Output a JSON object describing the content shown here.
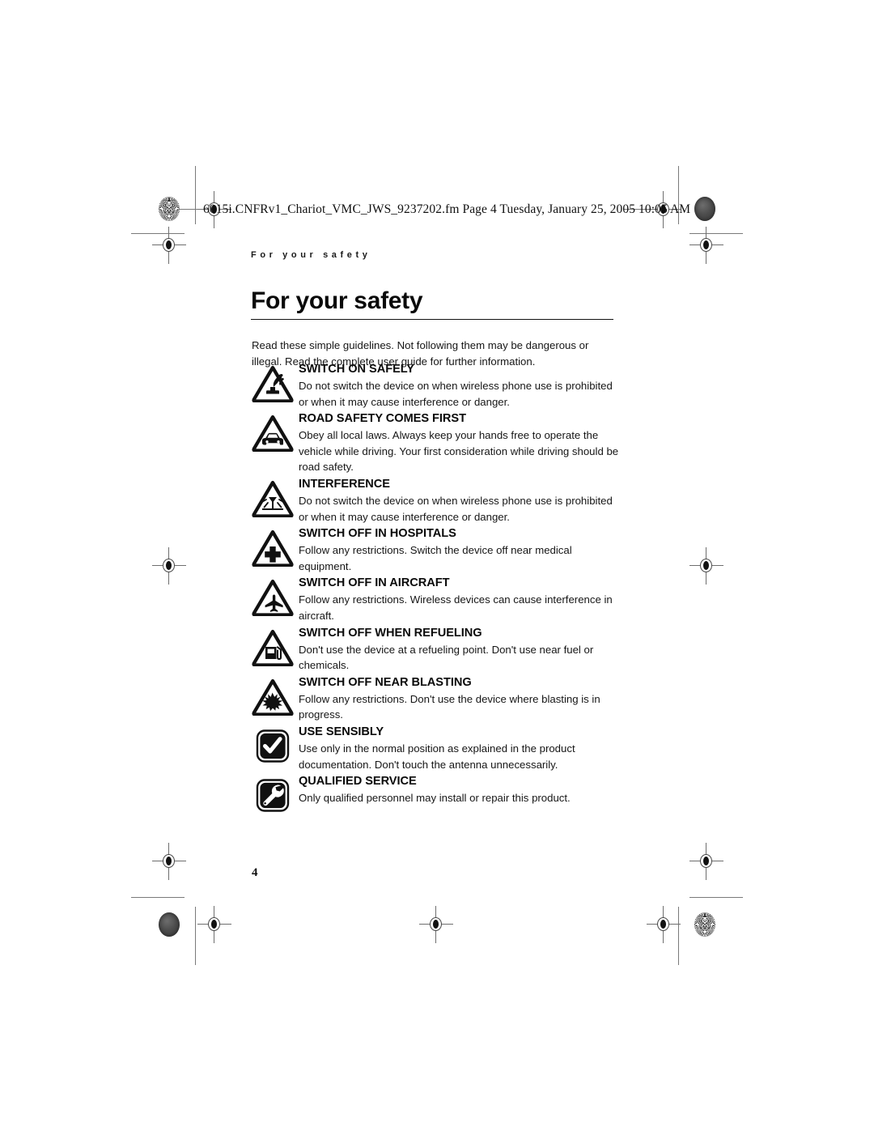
{
  "document": {
    "fm_header": "6015i.CNFRv1_Chariot_VMC_JWS_9237202.fm  Page 4  Tuesday, January 25, 2005  10:05 AM",
    "running_head": "For your safety",
    "title": "For your safety",
    "intro": "Read these simple guidelines. Not following them may be dangerous or illegal. Read the complete user guide for further information.",
    "page_number": "4"
  },
  "guidelines": [
    {
      "icon": "warning-triangle-hand-switch-icon",
      "heading": "SWITCH ON SAFELY",
      "text": "Do not switch the device on when wireless phone use is prohibited or when it may cause interference or danger."
    },
    {
      "icon": "warning-triangle-car-icon",
      "heading": "ROAD SAFETY COMES FIRST",
      "text": "Obey all local laws. Always keep your hands free to operate the vehicle while driving. Your first consideration while driving should be road safety."
    },
    {
      "icon": "warning-triangle-interference-antenna-icon",
      "heading": "INTERFERENCE",
      "text": "Do not switch the device on when wireless phone use is prohibited or when it may cause interference or danger."
    },
    {
      "icon": "warning-triangle-hospital-cross-icon",
      "heading": "SWITCH OFF IN HOSPITALS",
      "text": "Follow any restrictions. Switch the device off near medical equipment."
    },
    {
      "icon": "warning-triangle-aircraft-icon",
      "heading": "SWITCH OFF IN AIRCRAFT",
      "text": "Follow any restrictions. Wireless devices can cause interference in aircraft."
    },
    {
      "icon": "warning-triangle-fuel-pump-icon",
      "heading": "SWITCH OFF WHEN REFUELING",
      "text": "Don't use the device at a refueling point. Don't use near fuel or chemicals."
    },
    {
      "icon": "warning-triangle-blast-explosion-icon",
      "heading": "SWITCH OFF NEAR BLASTING",
      "text": "Follow any restrictions. Don't use the device where blasting is in progress."
    },
    {
      "icon": "rounded-square-checkmark-icon",
      "heading": "USE SENSIBLY",
      "text": "Use only in the normal position as explained in the product documentation. Don't touch the antenna unnecessarily."
    },
    {
      "icon": "rounded-square-wrench-icon",
      "heading": "QUALIFIED SERVICE",
      "text": "Only qualified personnel may install or repair this product."
    }
  ],
  "colors": {
    "ink": "#111111",
    "body_text": "#161616",
    "mark_gray": "#6e6e6e",
    "page_background": "#ffffff"
  }
}
